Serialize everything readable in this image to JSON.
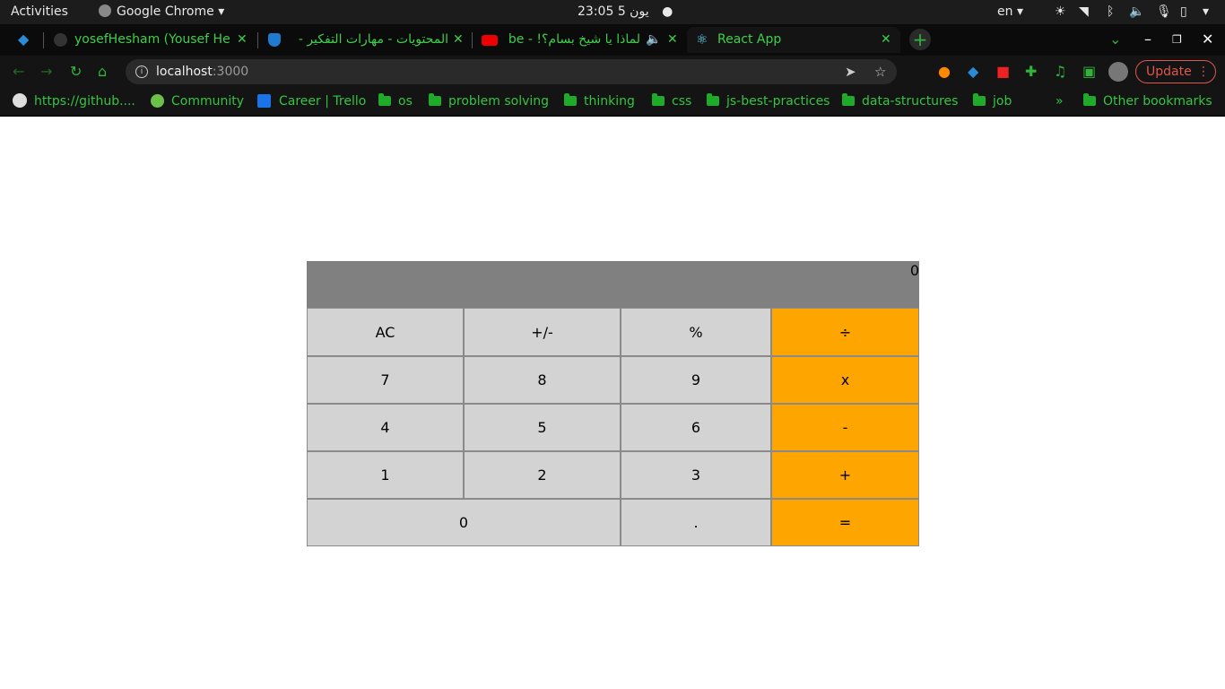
{
  "system": {
    "activities": "Activities",
    "app_name": "Google Chrome",
    "clock": "23:05",
    "date": "يون 5",
    "lang": "en"
  },
  "tabs": [
    {
      "title": "yosefHesham (Yousef He"
    },
    {
      "title": "المحتويات - مهارات التفكير -"
    },
    {
      "title": "لماذا يا شيخ بسام؟! - ube"
    },
    {
      "title": "React App"
    }
  ],
  "address": {
    "host": "localhost",
    "port": ":3000"
  },
  "update_label": "Update",
  "bookmarks": [
    {
      "label": "https://github...."
    },
    {
      "label": "Community"
    },
    {
      "label": "Career | Trello"
    },
    {
      "label": "os"
    },
    {
      "label": "problem solving"
    },
    {
      "label": "thinking"
    },
    {
      "label": "css"
    },
    {
      "label": "js-best-practices"
    },
    {
      "label": "data-structures"
    },
    {
      "label": "job"
    }
  ],
  "bookmarks_overflow": "»",
  "other_bookmarks": "Other bookmarks",
  "calculator": {
    "display": "0",
    "keys": [
      "AC",
      "+/-",
      "%",
      "÷",
      "7",
      "8",
      "9",
      "x",
      "4",
      "5",
      "6",
      "-",
      "1",
      "2",
      "3",
      "+",
      "0",
      ".",
      "="
    ]
  },
  "colors": {
    "display_bg": "#808080",
    "key_bg": "#d3d3d3",
    "operator_bg": "#ffa500"
  }
}
